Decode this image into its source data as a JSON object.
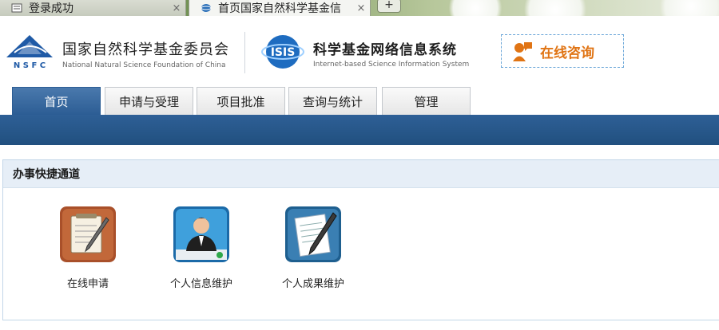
{
  "browser": {
    "tabs": [
      {
        "title": "登录成功",
        "close": "×",
        "icon": "page-icon"
      },
      {
        "title": "首页国家自然科学基金信",
        "close": "×",
        "icon": "isis-favicon"
      }
    ],
    "new_tab": "+"
  },
  "header": {
    "nsfc": {
      "abbr": "N S F C",
      "name_cn": "国家自然科学基金委员会",
      "name_en": "National Natural Science Foundation of China"
    },
    "isis": {
      "abbr": "ISIS",
      "name_cn": "科学基金网络信息系统",
      "name_en": "Internet-based Science Information System"
    },
    "consult": {
      "label": "在线咨询",
      "icon": "chat-person-icon"
    }
  },
  "nav": {
    "items": [
      {
        "label": "首页",
        "active": true
      },
      {
        "label": "申请与受理"
      },
      {
        "label": "项目批准"
      },
      {
        "label": "查询与统计"
      },
      {
        "label": "管理"
      }
    ]
  },
  "panel": {
    "title": "办事快捷通道",
    "shortcuts": [
      {
        "label": "在线申请",
        "icon": "pen-notepad-icon"
      },
      {
        "label": "个人信息维护",
        "icon": "user-profile-icon"
      },
      {
        "label": "个人成果维护",
        "icon": "document-pen-icon"
      }
    ]
  },
  "colors": {
    "nav_blue": "#2c5d94",
    "consult_orange": "#e07414",
    "panel_head": "#e6eef7"
  }
}
